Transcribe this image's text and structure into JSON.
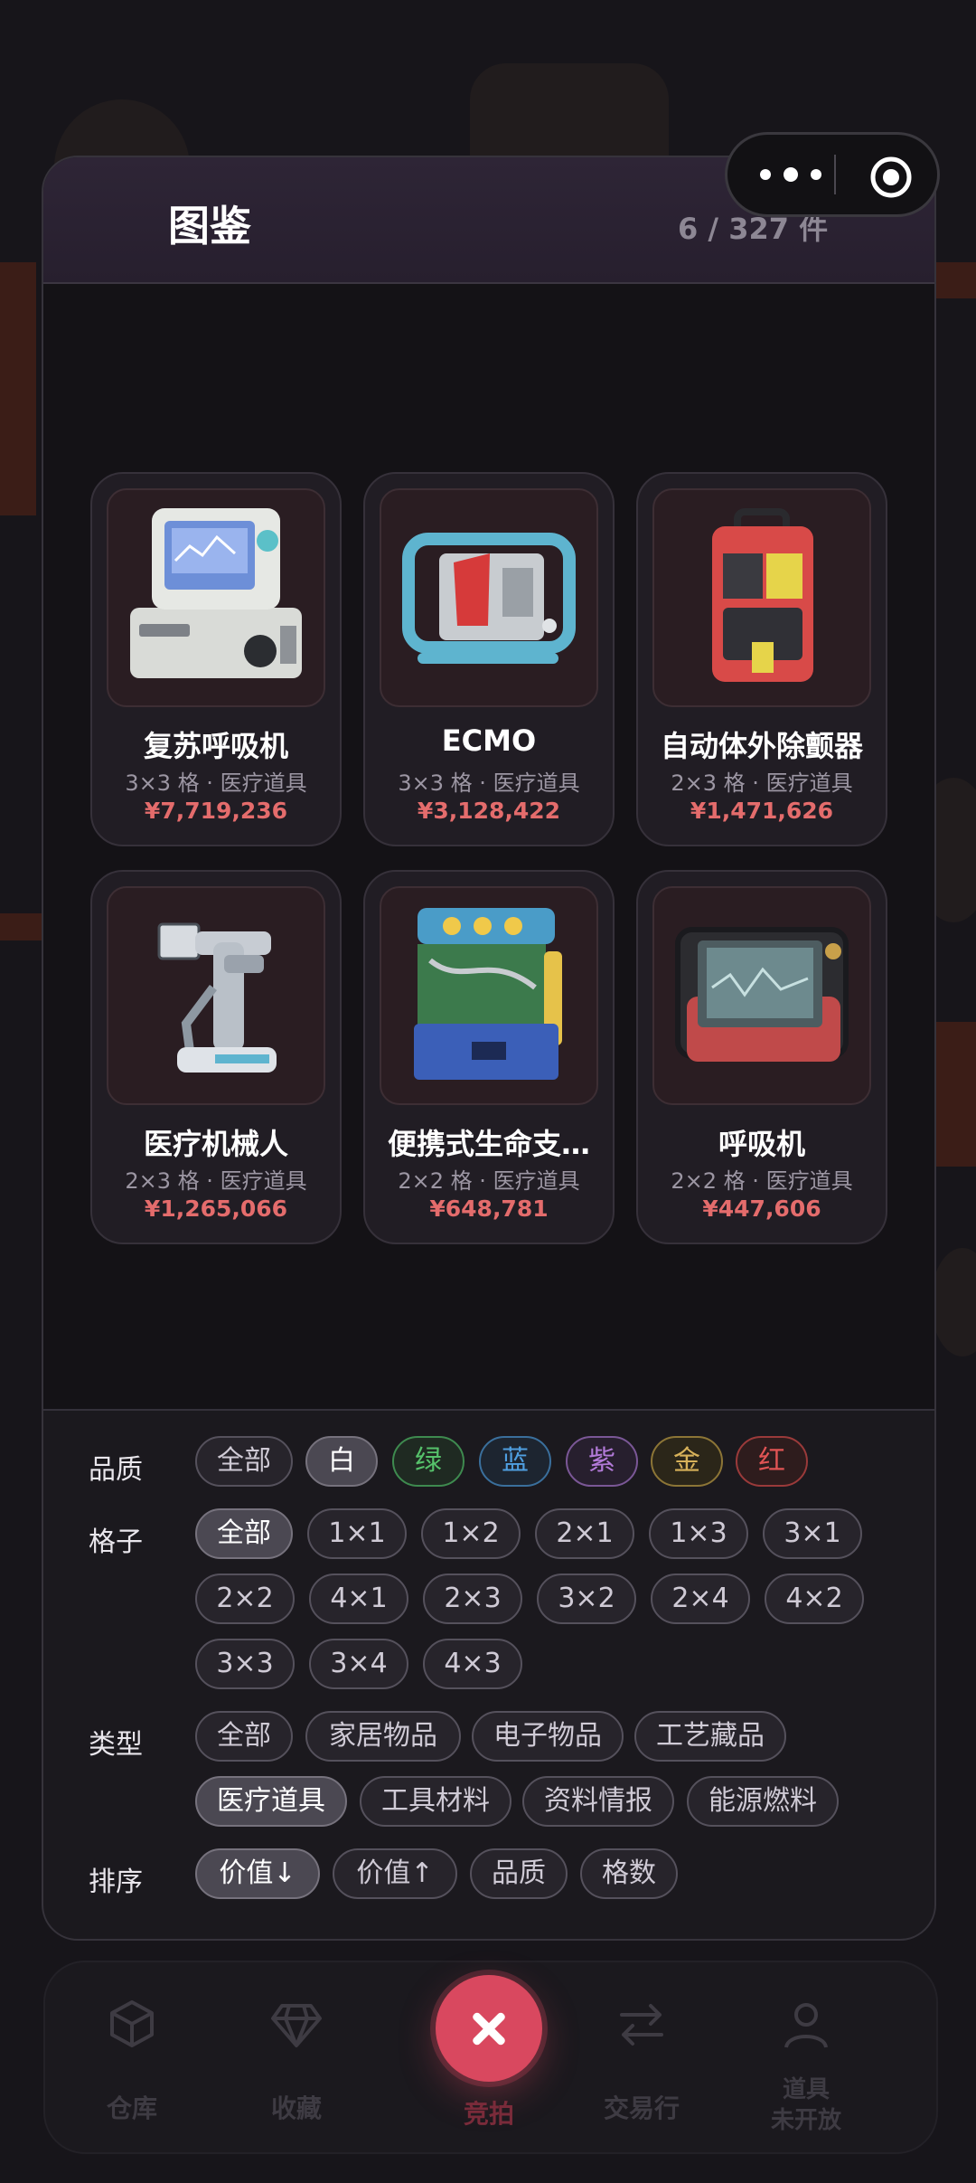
{
  "panel": {
    "title": "图鉴",
    "count": "6 / 327 件"
  },
  "items": [
    {
      "name": "复苏呼吸机",
      "meta": "3×3 格 · 医疗道具",
      "price": "¥7,719,236"
    },
    {
      "name": "ECMO",
      "meta": "3×3 格 · 医疗道具",
      "price": "¥3,128,422"
    },
    {
      "name": "自动体外除颤器",
      "meta": "2×3 格 · 医疗道具",
      "price": "¥1,471,626"
    },
    {
      "name": "医疗机械人",
      "meta": "2×3 格 · 医疗道具",
      "price": "¥1,265,066"
    },
    {
      "name": "便携式生命支…",
      "meta": "2×2 格 · 医疗道具",
      "price": "¥648,781"
    },
    {
      "name": "呼吸机",
      "meta": "2×2 格 · 医疗道具",
      "price": "¥447,606"
    }
  ],
  "filters": {
    "quality": {
      "label": "品质",
      "options": [
        "全部",
        "白",
        "绿",
        "蓝",
        "紫",
        "金",
        "红"
      ],
      "selected": "白",
      "colors": {
        "白": "#cfcad5",
        "绿": "#56c26b",
        "蓝": "#4f9fe0",
        "紫": "#b27ad8",
        "金": "#d8b25a",
        "红": "#e05454"
      }
    },
    "grid": {
      "label": "格子",
      "options": [
        "全部",
        "1×1",
        "1×2",
        "2×1",
        "1×3",
        "3×1",
        "2×2",
        "4×1",
        "2×3",
        "3×2",
        "2×4",
        "4×2",
        "3×3",
        "3×4",
        "4×3"
      ],
      "selected": "全部"
    },
    "type": {
      "label": "类型",
      "options": [
        "全部",
        "家居物品",
        "电子物品",
        "工艺藏品",
        "医疗道具",
        "工具材料",
        "资料情报",
        "能源燃料"
      ],
      "selected": "医疗道具"
    },
    "sort": {
      "label": "排序",
      "options": [
        "价值↓",
        "价值↑",
        "品质",
        "格数"
      ],
      "selected": "价值↓"
    }
  },
  "nav": {
    "warehouse": "仓库",
    "collection": "收藏",
    "auction": "竞拍",
    "trade": "交易行",
    "items": "道具\n未开放"
  }
}
